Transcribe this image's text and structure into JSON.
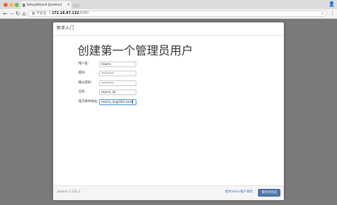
{
  "browser": {
    "tab_title": "SetupWizard [Jenkins]",
    "tab_close": "×",
    "back_glyph": "←",
    "forward_glyph": "→",
    "reload_glyph": "↻",
    "home_glyph": "⌂",
    "address": {
      "security_label": "不安全",
      "host": "172.16.47.132",
      "port": ":8080",
      "separator": " | "
    },
    "star_glyph": "☆",
    "menu_glyph": "⋮",
    "profile_glyph": "👤"
  },
  "dialog": {
    "title": "新手入门",
    "heading": "创建第一个管理员用户",
    "fields": [
      {
        "label": "用户名:",
        "value": "macro"
      },
      {
        "label": "密码:",
        "value": "•••••••"
      },
      {
        "label": "确认密码:",
        "value": "•••••••"
      },
      {
        "label": "全名:",
        "value": "macro_lai"
      },
      {
        "label": "电子邮件地址:",
        "value": "macro_lai@163.com"
      }
    ],
    "footer": {
      "version": "Jenkins 2.121.2",
      "skip_link": "使用admin账户继续",
      "save_button": "保存并完成"
    }
  },
  "colors": {
    "accent": "#4e79ad",
    "link": "#337ab7",
    "backdrop": "#7a7a7a",
    "focus": "#66afe9"
  }
}
